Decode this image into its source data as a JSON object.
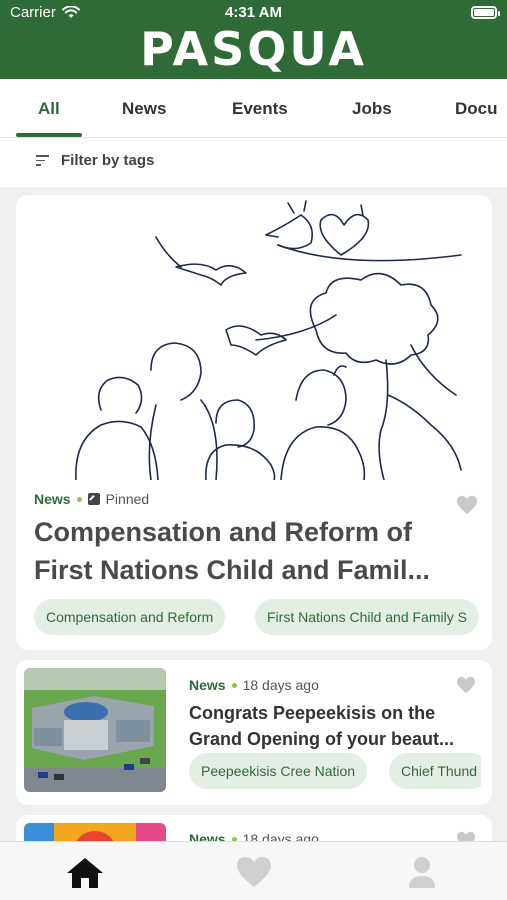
{
  "status_bar": {
    "carrier": "Carrier",
    "time": "4:31 AM"
  },
  "app": {
    "logo_text": "PASQUA",
    "brand_color": "#2f6b37",
    "accent_color": "#8dc63f"
  },
  "tabs": [
    {
      "label": "All",
      "active": true
    },
    {
      "label": "News",
      "active": false
    },
    {
      "label": "Events",
      "active": false
    },
    {
      "label": "Jobs",
      "active": false
    },
    {
      "label": "Docu",
      "active": false
    }
  ],
  "filter": {
    "label": "Filter by tags",
    "icon": "filter-lines-icon"
  },
  "feed": [
    {
      "category": "News",
      "pinned_label": "Pinned",
      "title_line1": "Compensation and Reform of",
      "title_line2": "First Nations Child and Famil...",
      "tags": [
        "Compensation and Reform",
        "First Nations Child and Family S"
      ],
      "image": "line-art-family-doves-tree-illustration",
      "favorite_icon": "heart-icon"
    },
    {
      "category": "News",
      "time": "18 days ago",
      "title_line1": "Congrats Peepeekisis on the",
      "title_line2": "Grand Opening of your beaut...",
      "tags": [
        "Peepeekisis Cree Nation",
        "Chief Thund"
      ],
      "image": "aerial-photo-building",
      "favorite_icon": "heart-icon"
    },
    {
      "category": "News",
      "time": "18 days ago",
      "image": "colorful-artwork",
      "favorite_icon": "heart-icon"
    }
  ],
  "bottom_nav": [
    {
      "icon": "home-icon",
      "active": true
    },
    {
      "icon": "heart-icon",
      "active": false
    },
    {
      "icon": "person-icon",
      "active": false
    }
  ]
}
